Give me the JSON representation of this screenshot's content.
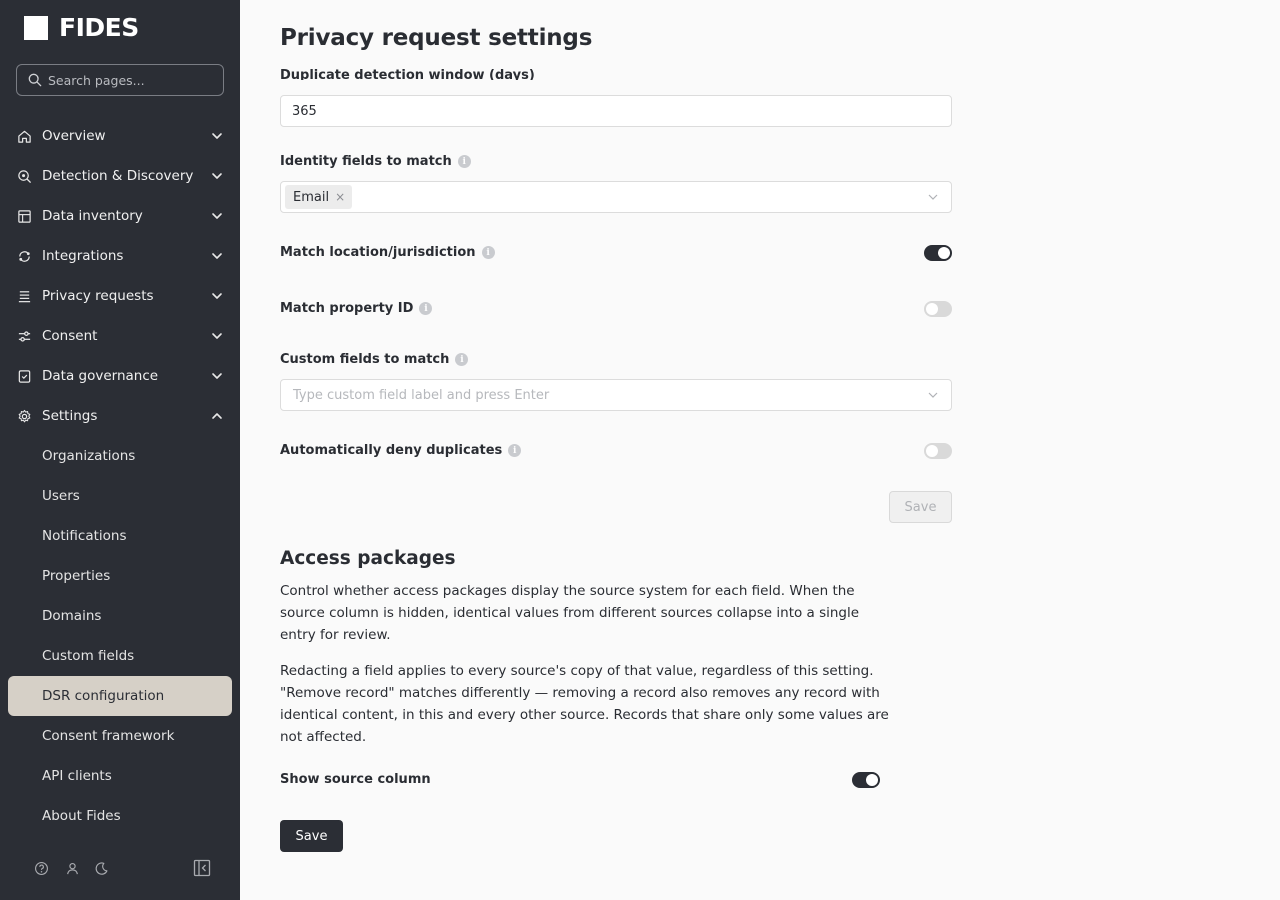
{
  "sidebar": {
    "logo_text": "FIDES",
    "search_placeholder": "Search pages...",
    "nav": [
      {
        "label": "Overview"
      },
      {
        "label": "Detection & Discovery"
      },
      {
        "label": "Data inventory"
      },
      {
        "label": "Integrations"
      },
      {
        "label": "Privacy requests"
      },
      {
        "label": "Consent"
      },
      {
        "label": "Data governance"
      },
      {
        "label": "Settings"
      }
    ],
    "settings_items": [
      {
        "label": "Organizations"
      },
      {
        "label": "Users"
      },
      {
        "label": "Notifications"
      },
      {
        "label": "Properties"
      },
      {
        "label": "Domains"
      },
      {
        "label": "Custom fields"
      },
      {
        "label": "DSR configuration"
      },
      {
        "label": "Consent framework"
      },
      {
        "label": "API clients"
      },
      {
        "label": "About Fides"
      }
    ],
    "active_item": "DSR configuration"
  },
  "main": {
    "title": "Privacy request settings",
    "duplicate_window": {
      "label": "Duplicate detection window (days)",
      "value": "365"
    },
    "identity_fields": {
      "label": "Identity fields to match",
      "tags": [
        "Email"
      ]
    },
    "match_location": {
      "label": "Match location/jurisdiction",
      "enabled": true
    },
    "match_property": {
      "label": "Match property ID",
      "enabled": false
    },
    "custom_fields": {
      "label": "Custom fields to match",
      "placeholder": "Type custom field label and press Enter"
    },
    "auto_deny": {
      "label": "Automatically deny duplicates",
      "enabled": false
    },
    "save_disabled_label": "Save",
    "access_packages": {
      "title": "Access packages",
      "paragraph1": "Control whether access packages display the source system for each field. When the source column is hidden, identical values from different sources collapse into a single entry for review.",
      "paragraph2": "Redacting a field applies to every source's copy of that value, regardless of this setting. \"Remove record\" matches differently — removing a record also removes any record with identical content, in this and every other source. Records that share only some values are not affected.",
      "show_source": {
        "label": "Show source column",
        "enabled": true
      },
      "save_label": "Save"
    }
  }
}
